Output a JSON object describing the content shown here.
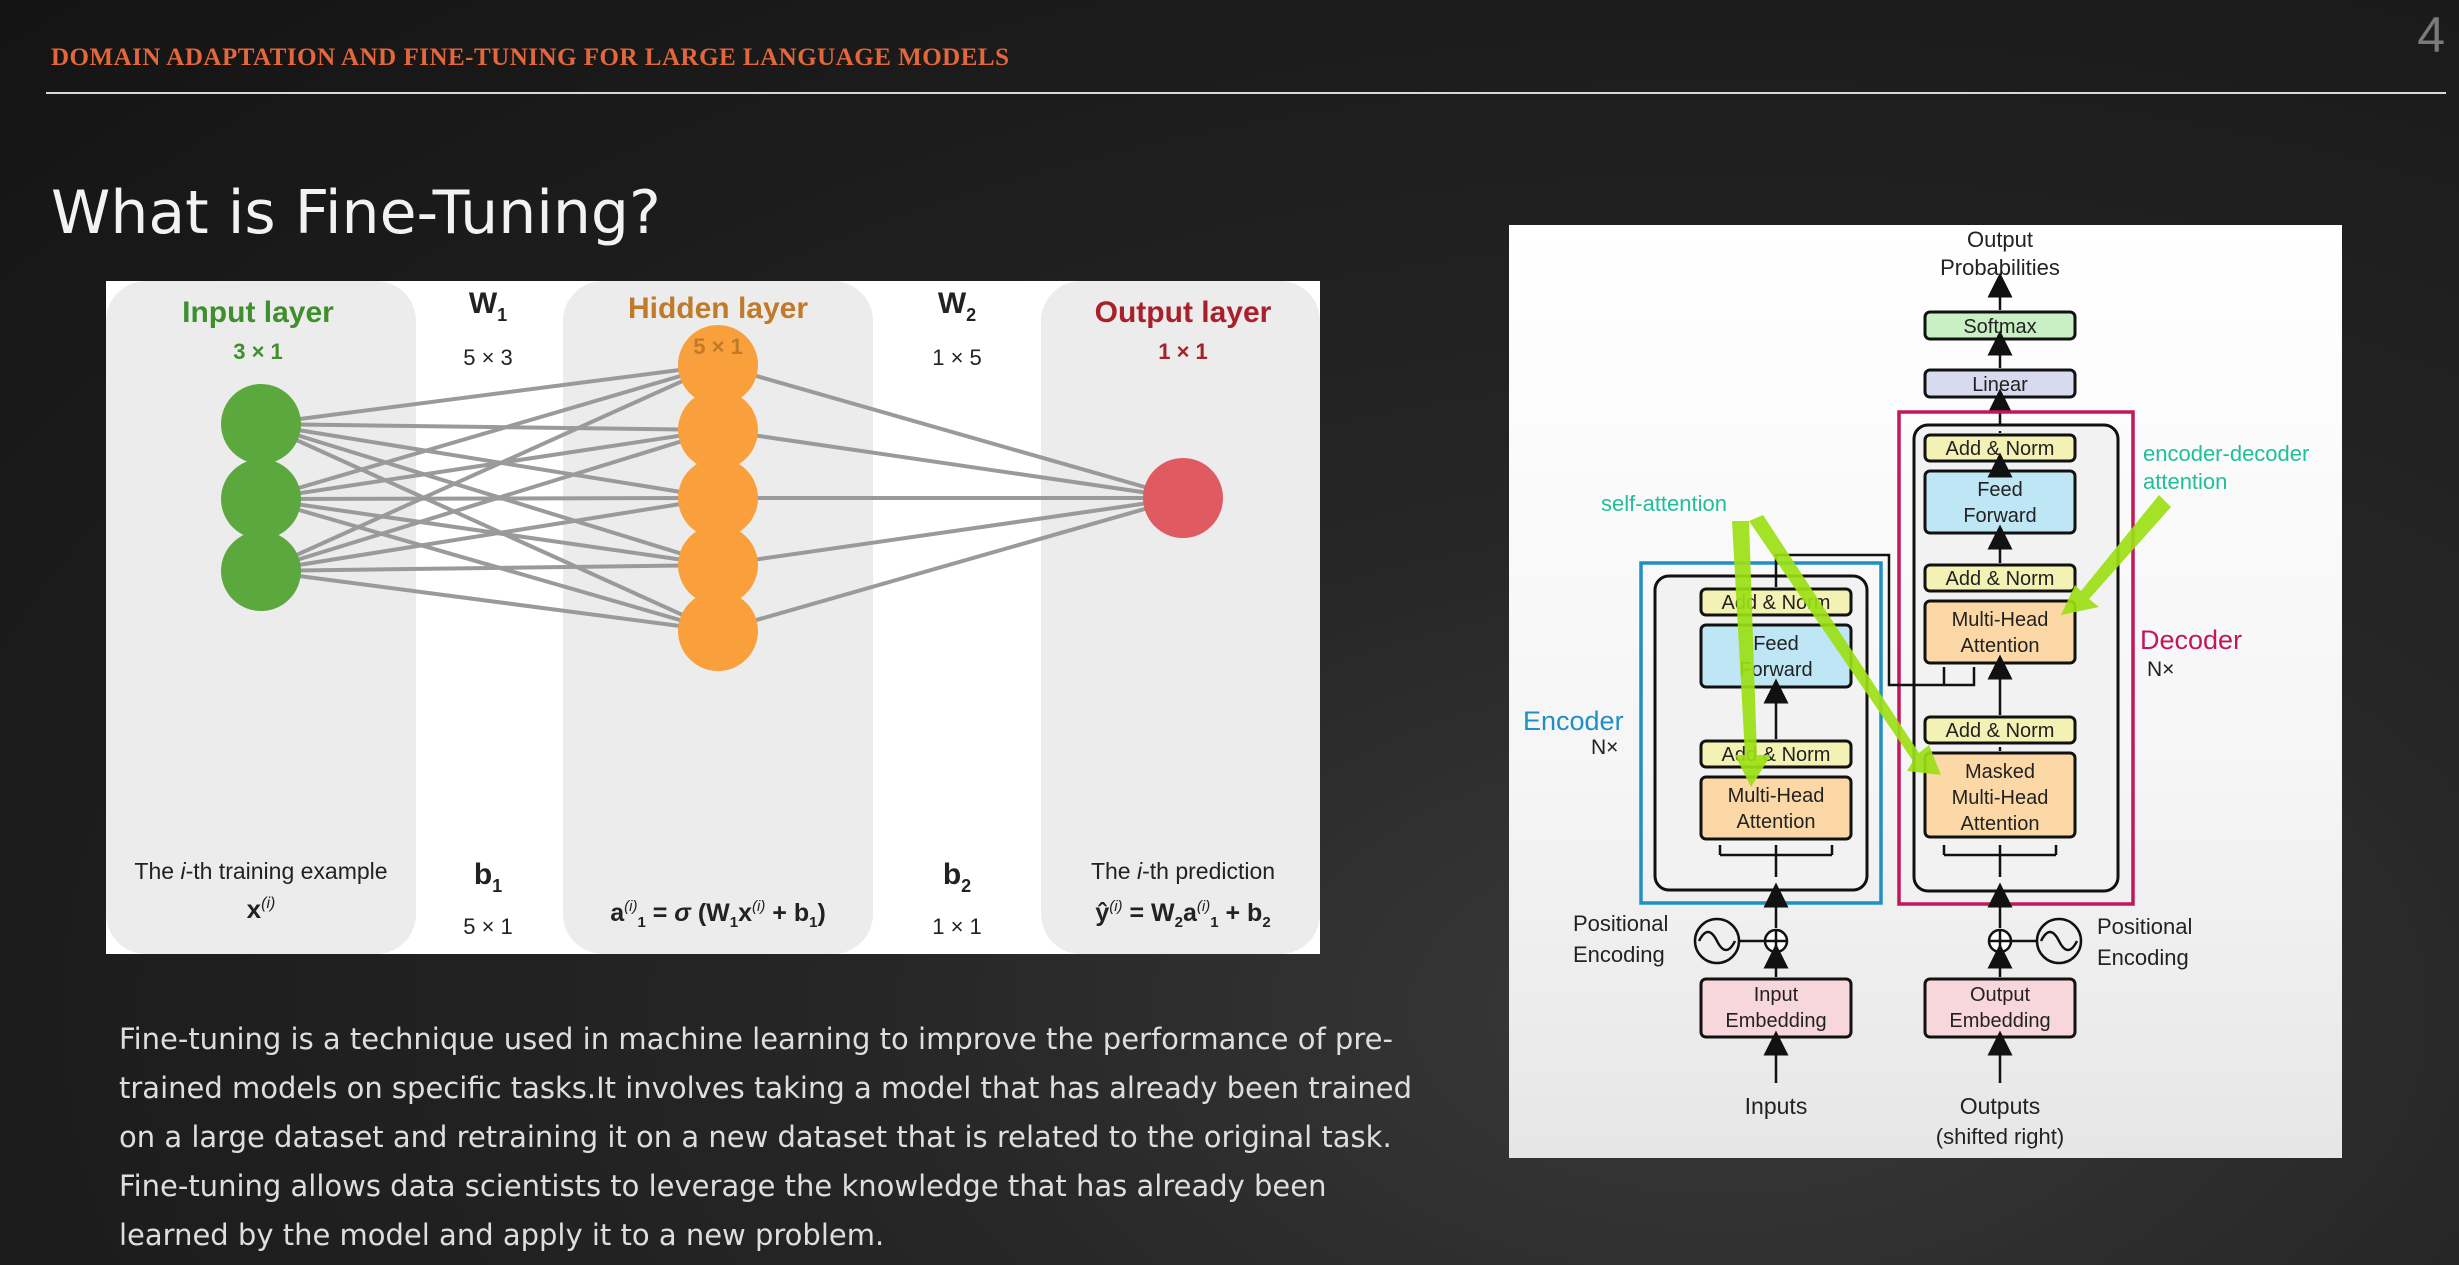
{
  "header": {
    "course_title": "DOMAIN ADAPTATION AND FINE-TUNING FOR LARGE LANGUAGE MODELS",
    "page_number": "4"
  },
  "slide": {
    "title": "What is Fine-Tuning?",
    "body": "Fine-tuning is a technique used in machine learning to improve the performance of pre-trained models on specific tasks.It involves taking a model that has already been trained on a large dataset and retraining it on a new dataset that is related to the original task. Fine-tuning allows data scientists to leverage the knowledge that has already been learned by the model and apply it to a new problem."
  },
  "neural_network": {
    "input_layer": {
      "label": "Input layer",
      "dims": "3 × 1",
      "caption": "The i-th training example",
      "formula": "x(i)",
      "color": "#3f8f2f",
      "node_color": "#5aa83e"
    },
    "w1": {
      "label": "W1",
      "dims": "5 × 3"
    },
    "b1": {
      "label": "b1",
      "dims": "5 × 1"
    },
    "hidden_layer": {
      "label": "Hidden layer",
      "dims": "5 × 1",
      "formula": "a(i)1 = σ (W1x(i) + b1)",
      "color": "#c07a2a",
      "node_color": "#f9a03c"
    },
    "w2": {
      "label": "W2",
      "dims": "1 × 5"
    },
    "b2": {
      "label": "b2",
      "dims": "1 × 1"
    },
    "output_layer": {
      "label": "Output layer",
      "dims": "1 × 1",
      "caption": "The i-th prediction",
      "formula": "ŷ(i) = W2a(i)1 + b2",
      "color": "#a8202a",
      "node_color": "#e05a62"
    },
    "input_nodes": 3,
    "hidden_nodes": 5,
    "output_nodes": 1
  },
  "transformer": {
    "output_probabilities": [
      "Output",
      "Probabilities"
    ],
    "softmax": "Softmax",
    "linear": "Linear",
    "add_norm": "Add & Norm",
    "feed_forward": [
      "Feed",
      "Forward"
    ],
    "multi_head_attention": [
      "Multi-Head",
      "Attention"
    ],
    "masked_multi_head_attention": [
      "Masked",
      "Multi-Head",
      "Attention"
    ],
    "encoder_label": "Encoder",
    "decoder_label": "Decoder",
    "nx": "N×",
    "positional_encoding": [
      "Positional",
      "Encoding"
    ],
    "input_embedding": [
      "Input",
      "Embedding"
    ],
    "output_embedding": [
      "Output",
      "Embedding"
    ],
    "inputs": "Inputs",
    "outputs": [
      "Outputs",
      "(shifted right)"
    ],
    "self_attention": "self-attention",
    "encoder_decoder_attention": [
      "encoder-decoder",
      "attention"
    ],
    "colors": {
      "encoder": "#1f8fc4",
      "decoder": "#c2185b",
      "annotation": "#1fbf9a",
      "arrow": "#9be015"
    }
  }
}
